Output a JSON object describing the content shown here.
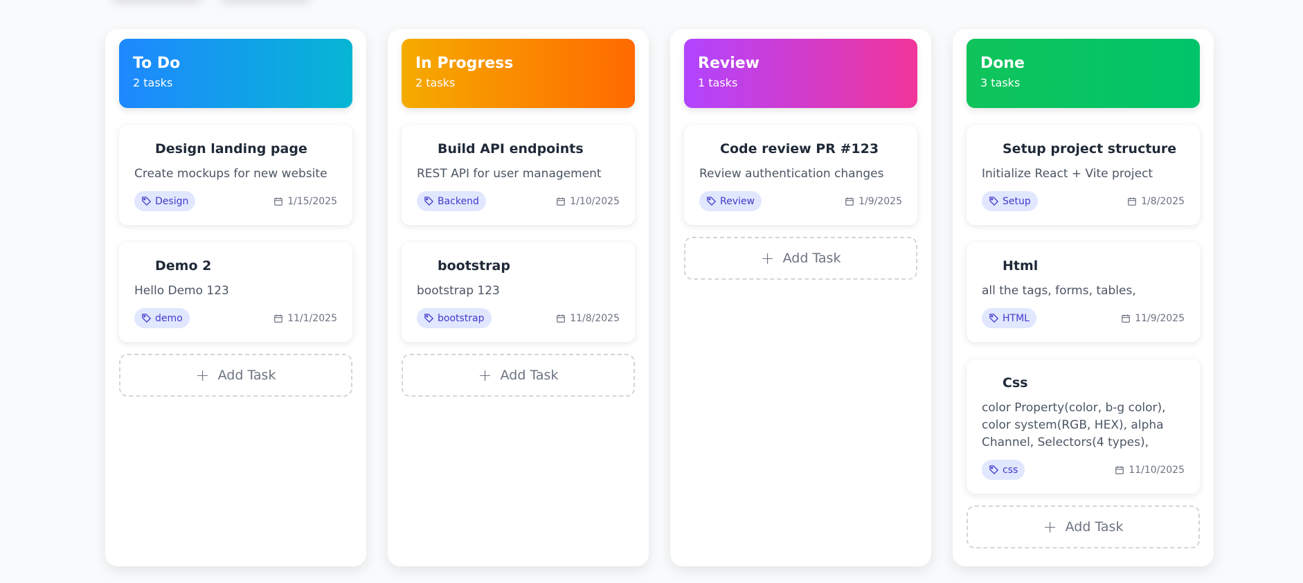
{
  "columns": [
    {
      "title": "To Do",
      "count": "2 tasks",
      "gradient": [
        "#1e88ff",
        "#06b6d4"
      ],
      "cards": [
        {
          "title": "Design landing page",
          "desc": "Create mockups for new website",
          "tag": "Design",
          "date": "1/15/2025"
        },
        {
          "title": "Demo 2",
          "desc": "Hello Demo 123",
          "tag": "demo",
          "date": "11/1/2025"
        }
      ],
      "add_label": "Add Task"
    },
    {
      "title": "In Progress",
      "count": "2 tasks",
      "gradient": [
        "#f5ab00",
        "#ff6a00"
      ],
      "cards": [
        {
          "title": "Build API endpoints",
          "desc": "REST API for user management",
          "tag": "Backend",
          "date": "1/10/2025"
        },
        {
          "title": "bootstrap",
          "desc": "bootstrap 123",
          "tag": "bootstrap",
          "date": "11/8/2025"
        }
      ],
      "add_label": "Add Task"
    },
    {
      "title": "Review",
      "count": "1 tasks",
      "gradient": [
        "#b144ff",
        "#f1359a"
      ],
      "cards": [
        {
          "title": "Code review PR #123",
          "desc": "Review authentication changes",
          "tag": "Review",
          "date": "1/9/2025"
        }
      ],
      "add_label": "Add Task"
    },
    {
      "title": "Done",
      "count": "3 tasks",
      "gradient": [
        "#10c45b",
        "#00c46a"
      ],
      "cards": [
        {
          "title": "Setup project structure",
          "desc": "Initialize React + Vite project",
          "tag": "Setup",
          "date": "1/8/2025"
        },
        {
          "title": "Html",
          "desc": "all the tags, forms, tables,",
          "tag": "HTML",
          "date": "11/9/2025"
        },
        {
          "title": "Css",
          "desc": "color Property(color, b-g color), color system(RGB, HEX), alpha Channel, Selectors(4 types),",
          "tag": "css",
          "date": "11/10/2025"
        }
      ],
      "add_label": "Add Task"
    }
  ],
  "icons": {
    "tag": "tag-icon",
    "date": "calendar-icon",
    "add": "plus-icon"
  },
  "colors": {
    "tag_bg": "#e0e7ff",
    "tag_text": "#4338ca"
  }
}
